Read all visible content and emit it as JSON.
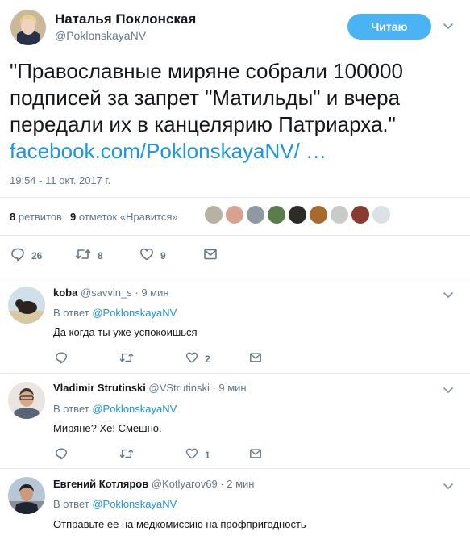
{
  "tweet": {
    "author_name": "Наталья Поклонская",
    "author_handle": "@PoklonskayaNV",
    "follow_label": "Читаю",
    "text": "\"Православные миряне собрали 100000 подписей за запрет \"Матильды\" и вчера передали их в канцелярию Патриарха.\"",
    "link": "facebook.com/PoklonskayaNV/ …",
    "timestamp": "19:54 - 11 окт. 2017 г.",
    "retweets_count": "8",
    "retweets_label": "ретвитов",
    "likes_count": "9",
    "likes_label": "отметок «Нравится»",
    "actions": {
      "replies": "26",
      "retweets": "8",
      "likes": "9"
    },
    "liker_colors": [
      "#b8b2a5",
      "#d7a28f",
      "#8d9aa4",
      "#5b7d4b",
      "#2f2b27",
      "#a9692c",
      "#c9cbc8",
      "#8a3b2e",
      "#dbe1e6"
    ]
  },
  "replies": [
    {
      "name": "koba",
      "handle": "@savvin_s",
      "time": "· 9 мин",
      "reply_prefix": "В ответ",
      "reply_to": "@PoklonskayaNV",
      "text": "Да когда ты уже успокоишься",
      "likes": "2"
    },
    {
      "name": "Vladimir Strutinski",
      "handle": "@VStrutinski",
      "time": "· 9 мин",
      "reply_prefix": "В ответ",
      "reply_to": "@PoklonskayaNV",
      "text": "Миряне? Хе! Смешно.",
      "likes": "1"
    },
    {
      "name": "Евгений Котляров",
      "handle": "@Kotlyarov69",
      "time": "· 2 мин",
      "reply_prefix": "В ответ",
      "reply_to": "@PoklonskayaNV",
      "text": "Отправьте ее на медкомиссию на профпригодность"
    }
  ]
}
